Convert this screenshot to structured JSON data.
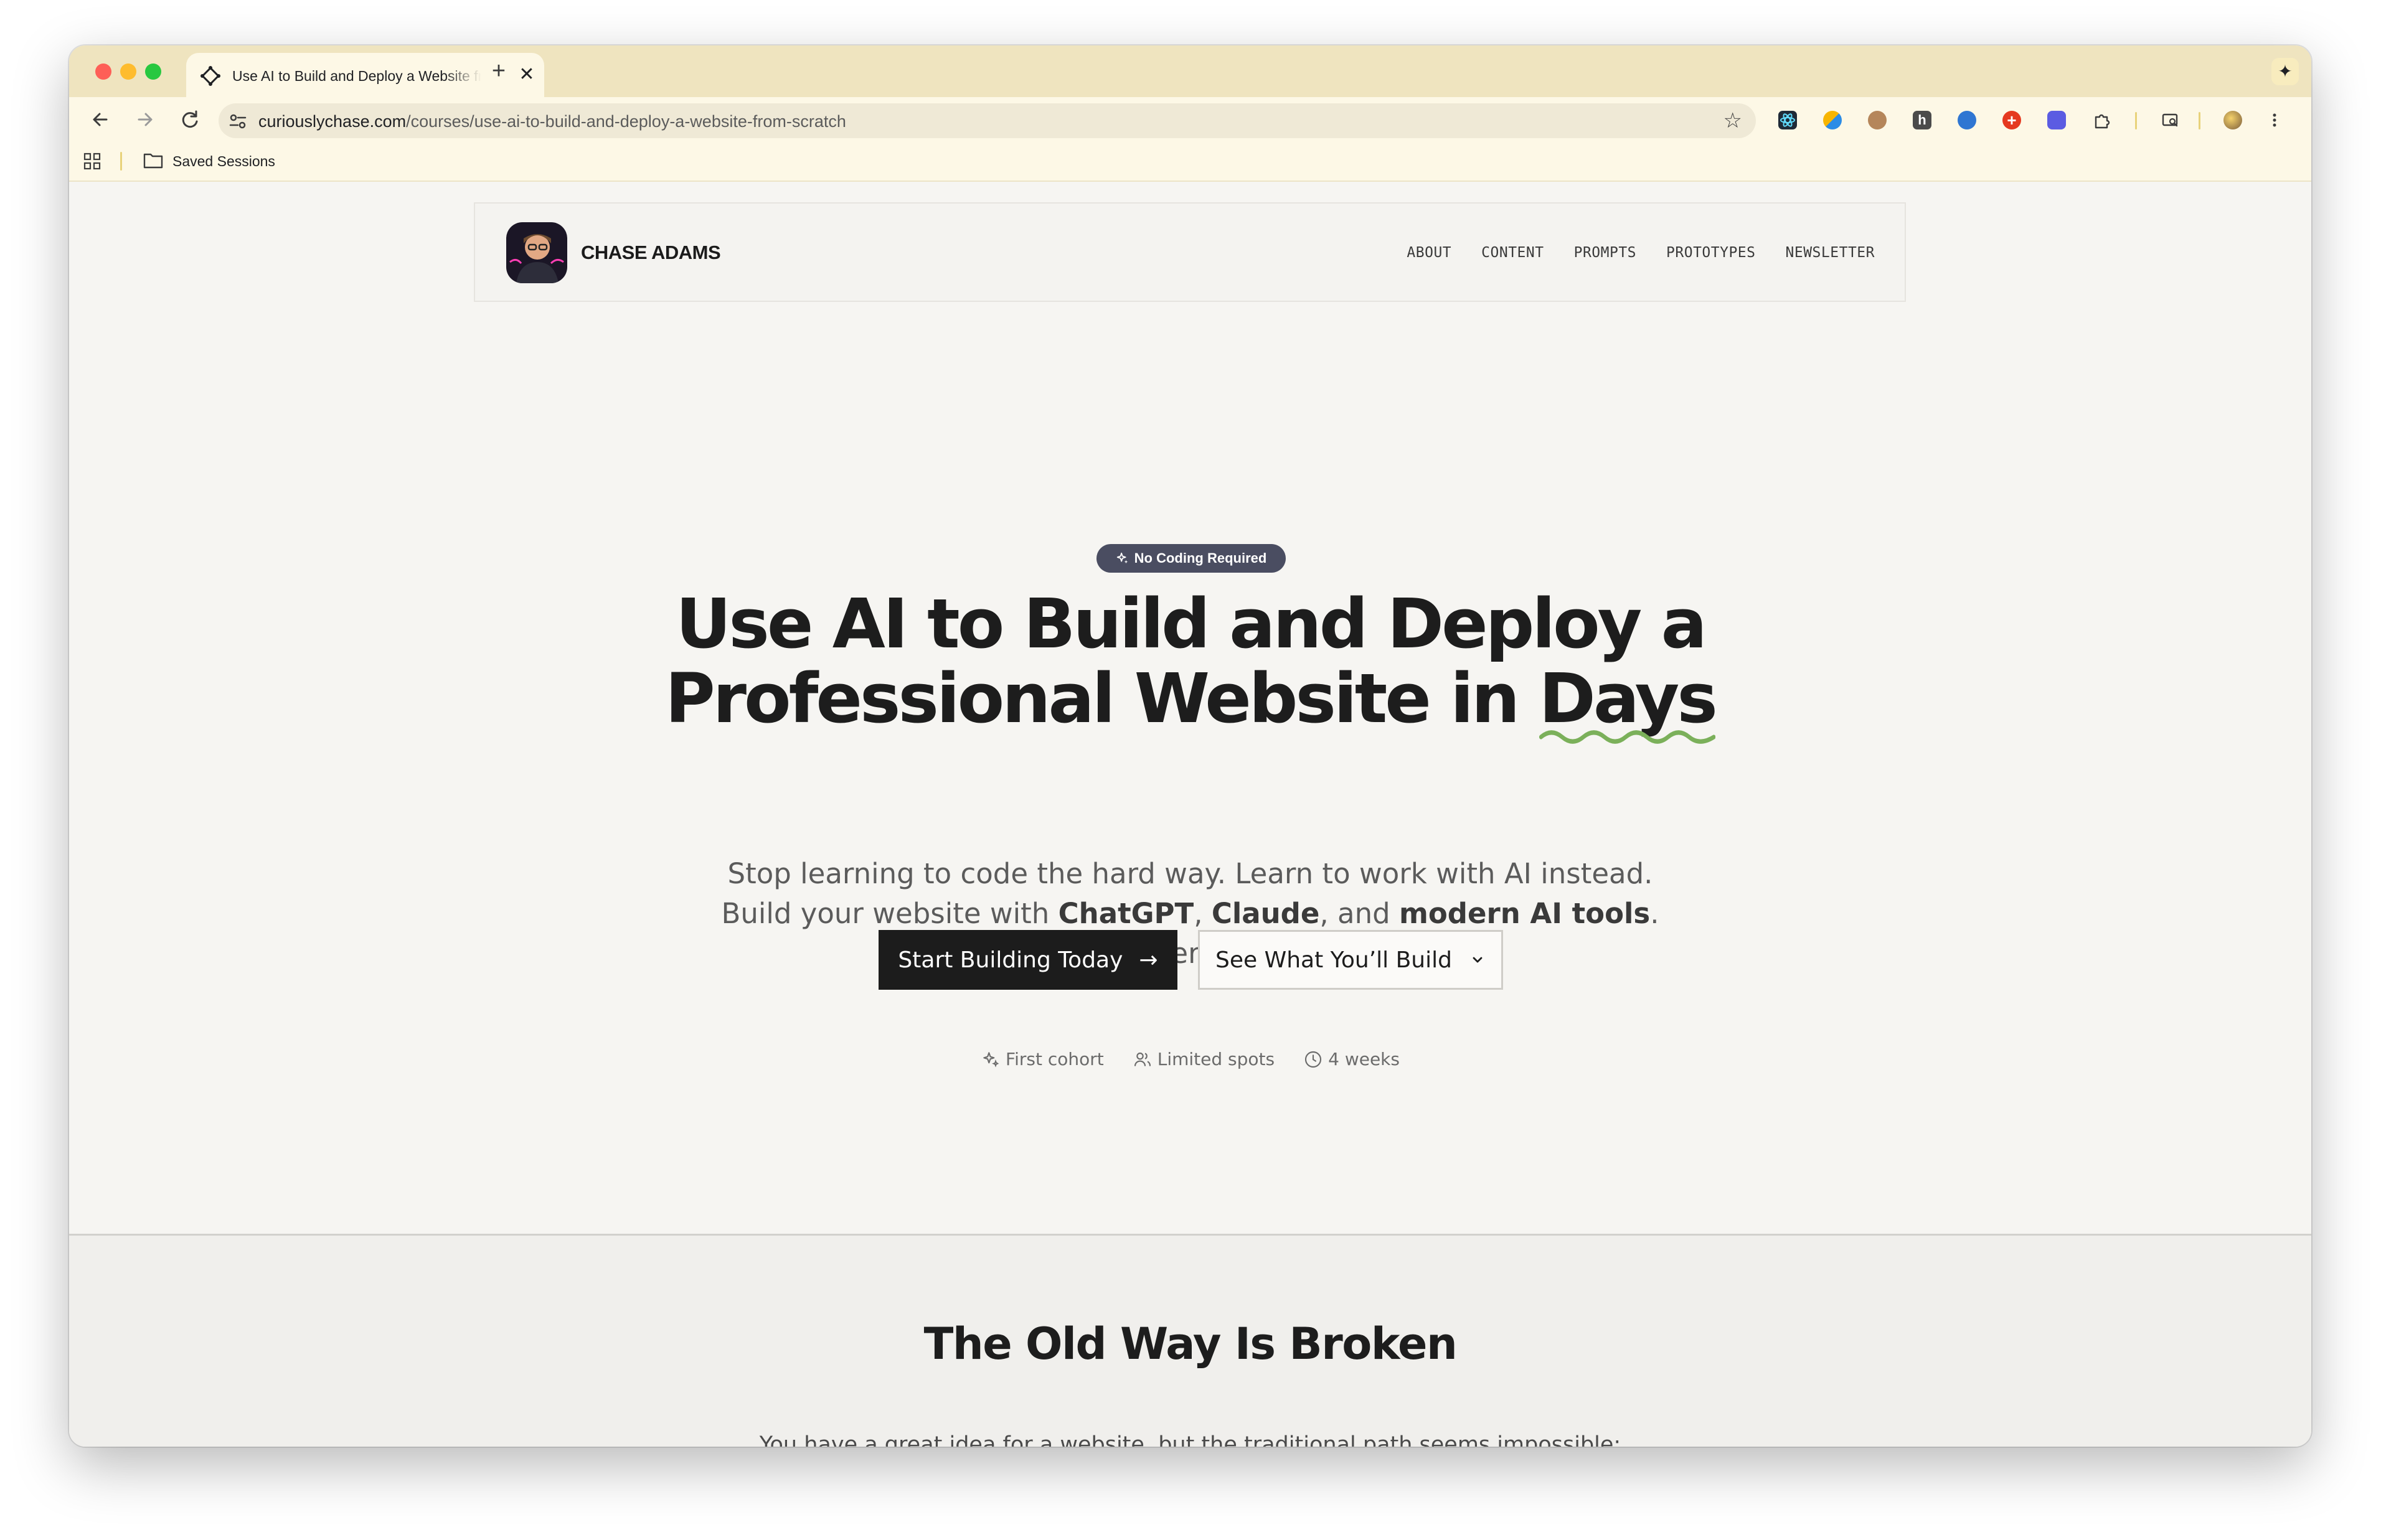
{
  "browser": {
    "tab_title": "Use AI to Build and Deploy a Website from Scratch",
    "tab_close_glyph": "✕",
    "new_tab_glyph": "+",
    "gemini_glyph": "✦",
    "url_domain": "curiouslychase.com",
    "url_path": "/courses/use-ai-to-build-and-deploy-a-website-from-scratch",
    "bookmark_folder": "Saved Sessions",
    "extension_icons": [
      "react-devtools-icon",
      "color-picker-icon",
      "owl-icon",
      "h-extension-icon",
      "clock-extension-icon",
      "red-plus-extension-icon",
      "gear-extension-icon",
      "puzzle-extensions-icon"
    ]
  },
  "site": {
    "brand": "CHASE ADAMS",
    "nav": [
      "ABOUT",
      "CONTENT",
      "PROMPTS",
      "PROTOTYPES",
      "NEWSLETTER"
    ]
  },
  "hero": {
    "badge": "No Coding Required",
    "title_line1": "Use AI to Build and Deploy a",
    "title_line2_prefix": "Professional Website in ",
    "title_highlight": "Days",
    "subtitle_line1": "Stop learning to code the hard way. Learn to work with AI instead.",
    "subtitle_line2_prefix": "Build your website with ",
    "subtitle_bold1": "ChatGPT",
    "subtitle_comma": ", ",
    "subtitle_bold2": "Claude",
    "subtitle_and": ", and ",
    "subtitle_bold3": "modern AI tools",
    "subtitle_period": ".",
    "subtitle_line3": "No coding experience required.",
    "cta_primary": "Start Building Today",
    "cta_primary_arrow": "→",
    "cta_secondary": "See What You’ll Build",
    "meta": [
      "First cohort",
      "Limited spots",
      "4 weeks"
    ]
  },
  "section2": {
    "title": "The Old Way Is Broken",
    "text": "You have a great idea for a website, but the traditional path seems impossible:"
  },
  "colors": {
    "tab_strip": "#efe4bf",
    "toolbar": "#fdf8e6",
    "badge_bg": "#4a4d61",
    "cta_primary_bg": "#1c1c1c",
    "highlight_underline": "#7bb05a"
  }
}
